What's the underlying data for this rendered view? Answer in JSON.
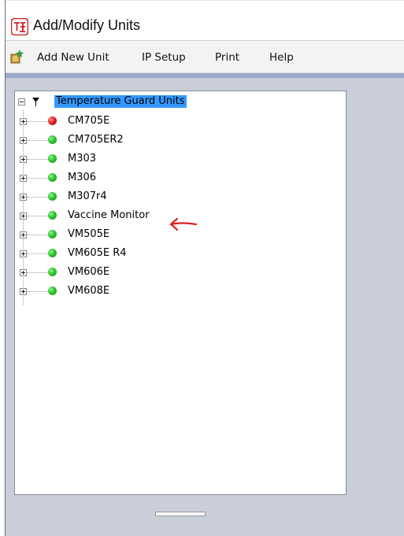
{
  "window": {
    "title": "Add/Modify Units"
  },
  "menu": {
    "items": [
      {
        "label": "Add New Unit"
      },
      {
        "label": "IP Setup"
      },
      {
        "label": "Print"
      },
      {
        "label": "Help"
      }
    ]
  },
  "tree": {
    "root_label": "Temperature Guard Units",
    "nodes": [
      {
        "label": "CM705E",
        "status": "red"
      },
      {
        "label": "CM705ER2",
        "status": "green"
      },
      {
        "label": "M303",
        "status": "green"
      },
      {
        "label": "M306",
        "status": "green"
      },
      {
        "label": "M307r4",
        "status": "green"
      },
      {
        "label": "Vaccine Monitor",
        "status": "green"
      },
      {
        "label": "VM505E",
        "status": "green"
      },
      {
        "label": "VM605E R4",
        "status": "green"
      },
      {
        "label": "VM606E",
        "status": "green"
      },
      {
        "label": "VM608E",
        "status": "green"
      }
    ]
  },
  "colors": {
    "selection": "#3399ff",
    "status_green": "#2fc42f",
    "status_red": "#e02020",
    "annotation": "#e02020"
  }
}
